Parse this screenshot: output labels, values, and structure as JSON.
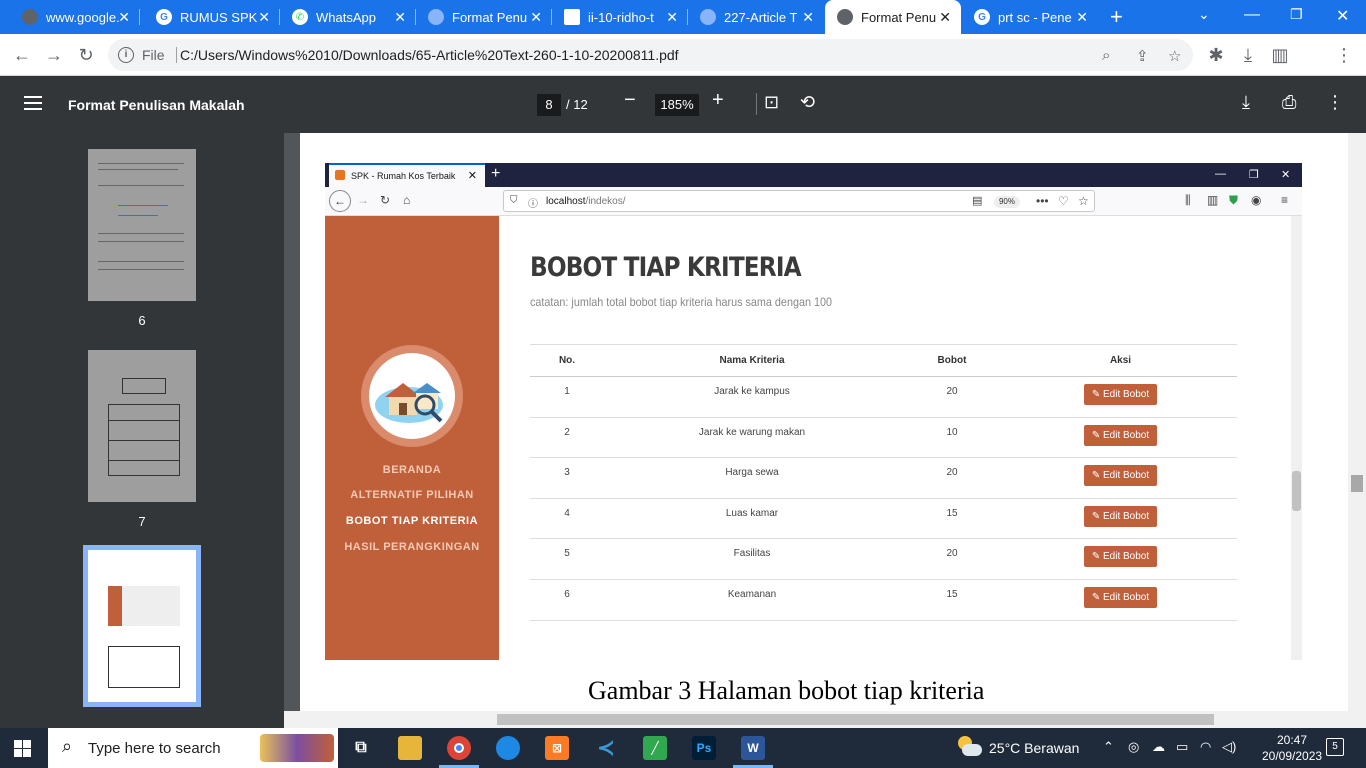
{
  "browser": {
    "tabs": [
      {
        "label": "www.google.",
        "icon": "chrome-icon"
      },
      {
        "label": "RUMUS SPK",
        "icon": "google-g-icon"
      },
      {
        "label": "WhatsApp",
        "icon": "whatsapp-icon"
      },
      {
        "label": "Format Penu",
        "icon": "globe-icon"
      },
      {
        "label": "ii-10-ridho-t",
        "icon": "document-icon"
      },
      {
        "label": "227-Article T",
        "icon": "globe-icon"
      },
      {
        "label": "Format Penu",
        "icon": "globe-icon",
        "active": true
      },
      {
        "label": "prt sc - Pene",
        "icon": "google-g-icon"
      }
    ],
    "address": {
      "scheme_label": "File",
      "url": "C:/Users/Windows%2010/Downloads/65-Article%20Text-260-1-10-20200811.pdf"
    }
  },
  "pdf": {
    "title": "Format Penulisan Makalah",
    "current_page": "8",
    "total_pages": "/ 12",
    "zoom": "185%",
    "thumb_labels": [
      "6",
      "7",
      "8"
    ]
  },
  "embedded": {
    "tab_title": "SPK - Rumah Kos Terbaik",
    "url_host": "localhost",
    "url_path": "/indekos/",
    "zoom": "90%",
    "sidebar": [
      "BERANDA",
      "ALTERNATIF PILIHAN",
      "BOBOT TIAP KRITERIA",
      "HASIL PERANGKINGAN"
    ],
    "heading": "BOBOT TIAP KRITERIA",
    "note": "catatan: jumlah total bobot tiap kriteria harus sama dengan 100",
    "table": {
      "headers": [
        "No.",
        "Nama Kriteria",
        "Bobot",
        "Aksi"
      ],
      "rows": [
        [
          "1",
          "Jarak ke kampus",
          "20"
        ],
        [
          "2",
          "Jarak ke warung makan",
          "10"
        ],
        [
          "3",
          "Harga sewa",
          "20"
        ],
        [
          "4",
          "Luas kamar",
          "15"
        ],
        [
          "5",
          "Fasilitas",
          "20"
        ],
        [
          "6",
          "Keamanan",
          "15"
        ]
      ],
      "action_label": "Edit Bobot"
    },
    "accent_color": "#c0603a"
  },
  "caption": "Gambar 3 Halaman bobot tiap kriteria",
  "taskbar": {
    "search_placeholder": "Type here to search",
    "weather": "25°C  Berawan",
    "time": "20:47",
    "date": "20/09/2023",
    "notification_count": "5"
  }
}
